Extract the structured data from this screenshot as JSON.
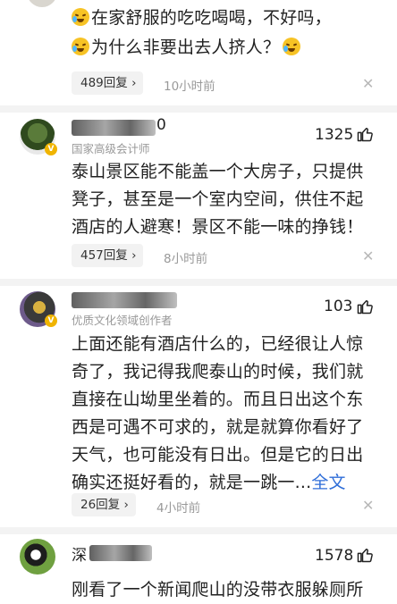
{
  "comment0": {
    "line1": "在家舒服的吃吃喝喝，不好吗，",
    "line2": "为什么非要出去人挤人？",
    "replies": "489回复",
    "time": "10小时前"
  },
  "comment1": {
    "name_visible": "0",
    "title": "国家高级会计师",
    "likes": "1325",
    "lines": [
      "泰山景区能不能盖一个大房子，只提供",
      "凳子，甚至是一个室内空间，供住不起",
      "酒店的人避寒！景区不能一味的挣钱！"
    ],
    "replies": "457回复",
    "time": "8小时前"
  },
  "comment2": {
    "title": "优质文化领域创作者",
    "likes": "103",
    "lines": [
      "上面还能有酒店什么的，已经很让人惊",
      "奇了，我记得我爬泰山的时候，我们就",
      "直接在山坳里坐着的。而且日出这个东",
      "西是可遇不可求的，就是就算你看好了",
      "天气，也可能没有日出。但是它的日出",
      "确实还挺好看的，就是一跳一..."
    ],
    "more_label": "全文",
    "replies": "26回复",
    "time": "4小时前"
  },
  "comment3": {
    "name_visible": "深",
    "likes": "1578",
    "line1": "刚看了一个新闻爬山的没带衣服躲厕所"
  },
  "icons": {
    "chevron": "chevron-right-icon",
    "close": "close-icon",
    "like": "thumbs-up-icon",
    "emoji": "crying-laughing-emoji"
  }
}
